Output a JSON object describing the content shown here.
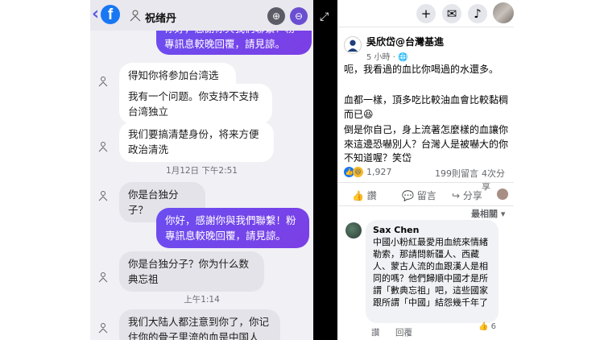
{
  "messenger": {
    "contact_name": "祝绪丹",
    "partial_top_message": "你好，感謝你與我們聯繫！粉專訊息較晚回覆，請見諒。",
    "messages": [
      {
        "dir": "in",
        "text": "得知你将参加台湾选举"
      },
      {
        "dir": "in",
        "text": "我有一个问题。你支持不支持台湾独立"
      },
      {
        "dir": "in",
        "text": "我们要搞清楚身份，将来方便政治清洗"
      },
      {
        "dir": "in",
        "text": "你是台独分子？"
      },
      {
        "dir": "out",
        "text": "你好，感謝你與我們聯繫！粉專訊息較晚回覆，請見諒。"
      },
      {
        "dir": "in",
        "text": "你是台独分子？你为什么数典忘祖"
      },
      {
        "dir": "in",
        "text": "我们大陆人都注意到你了，你记住你的骨子里流的血是中国人"
      }
    ],
    "timestamps": [
      "1月12日 下午2:51",
      "上午1:14"
    ]
  },
  "post": {
    "author": "吳欣岱@台灣基進",
    "meta": "5 小時 · 🌐",
    "paragraphs": [
      "呃，我看過的血比你喝過的水還多。",
      "血都一樣，頂多吃比較油血會比較黏稠而已😆",
      "倒是你自己，身上流著怎麼樣的血讓你來這邊恐嚇別人？台灣人是被嚇大的你不知道喔？笑岱"
    ],
    "reaction_count": "1,927",
    "comment_count": "199則留言",
    "share_count": "4次分享",
    "actions": {
      "like": "讚",
      "comment": "留言",
      "share": "分享"
    },
    "sort_label": "最相關",
    "comment": {
      "name": "Sax Chen",
      "text": "中國小粉紅最愛用血統來情緒勒索，那請問新疆人、西藏人、蒙古人流的血跟漢人是相同的嗎？他們歸順中國才是所謂「數典忘祖」吧，這些國家跟所謂「中國」結怨幾千年了",
      "reaction_count": "6",
      "like_label": "讚",
      "reply_label": "回覆"
    }
  }
}
